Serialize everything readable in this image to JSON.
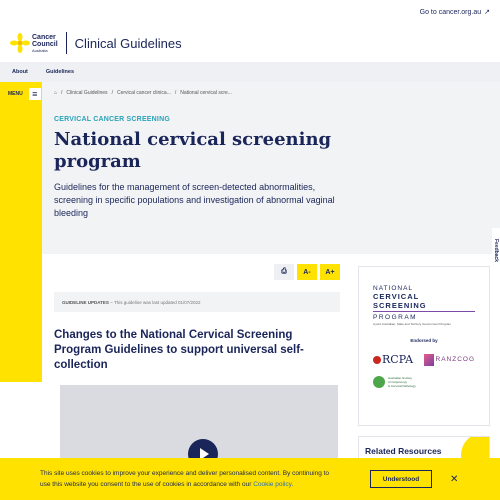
{
  "topbar": {
    "link": "Go to cancer.org.au",
    "link_icon": "external-link-icon"
  },
  "header": {
    "logo_line1": "Cancer",
    "logo_line2": "Council",
    "logo_line3": "Australia",
    "site_title": "Clinical Guidelines"
  },
  "nav": {
    "items": [
      {
        "label": "About"
      },
      {
        "label": "Guidelines"
      }
    ]
  },
  "menu": {
    "label": "MENU",
    "icon": "hamburger-icon"
  },
  "breadcrumb": {
    "items": [
      "Clinical Guidelines",
      "Cervical cancer clinica...",
      "National cervical scre..."
    ],
    "home_icon": "home-icon"
  },
  "hero": {
    "eyebrow": "CERVICAL CANCER SCREENING",
    "title": "National cervical screening program",
    "subtitle": "Guidelines for the management of screen-detected abnormalities, screening in specific populations and investigation of abnormal vaginal bleeding"
  },
  "tools": {
    "print_icon": "print-icon",
    "decrease": "A-",
    "increase": "A+"
  },
  "updated": {
    "label": "GUIDELINE UPDATES",
    "text": "This guideline was last updated 01/07/2022"
  },
  "content": {
    "section_title": "Changes to the National Cervical Screening Program Guidelines to support universal self-collection"
  },
  "sidebar": {
    "ncsp_line1": "NATIONAL",
    "ncsp_line2": "CERVICAL SCREENING",
    "ncsp_line3": "PROGRAM",
    "ncsp_line4": "A joint Australian, State and Territory Government Program",
    "endorsed": "Endorsed by",
    "rcpa": "RCPA",
    "ranzcog": "RANZCOG",
    "asccp_line1": "Australian Society",
    "asccp_line2": "of Colposcopy",
    "asccp_line3": "& Cervical Pathology",
    "related": "Related Resources"
  },
  "feedback": "Feedback",
  "cookie": {
    "text": "This site uses cookies to improve your experience and deliver personalised content. By continuing to use this website you consent to the use of cookies in accordance with our ",
    "link": "Cookie policy",
    "text_end": ".",
    "button": "Understood",
    "close_icon": "close-icon"
  },
  "colors": {
    "brand_yellow": "#ffe200",
    "navy": "#1a2559",
    "teal": "#2aa3b8"
  }
}
